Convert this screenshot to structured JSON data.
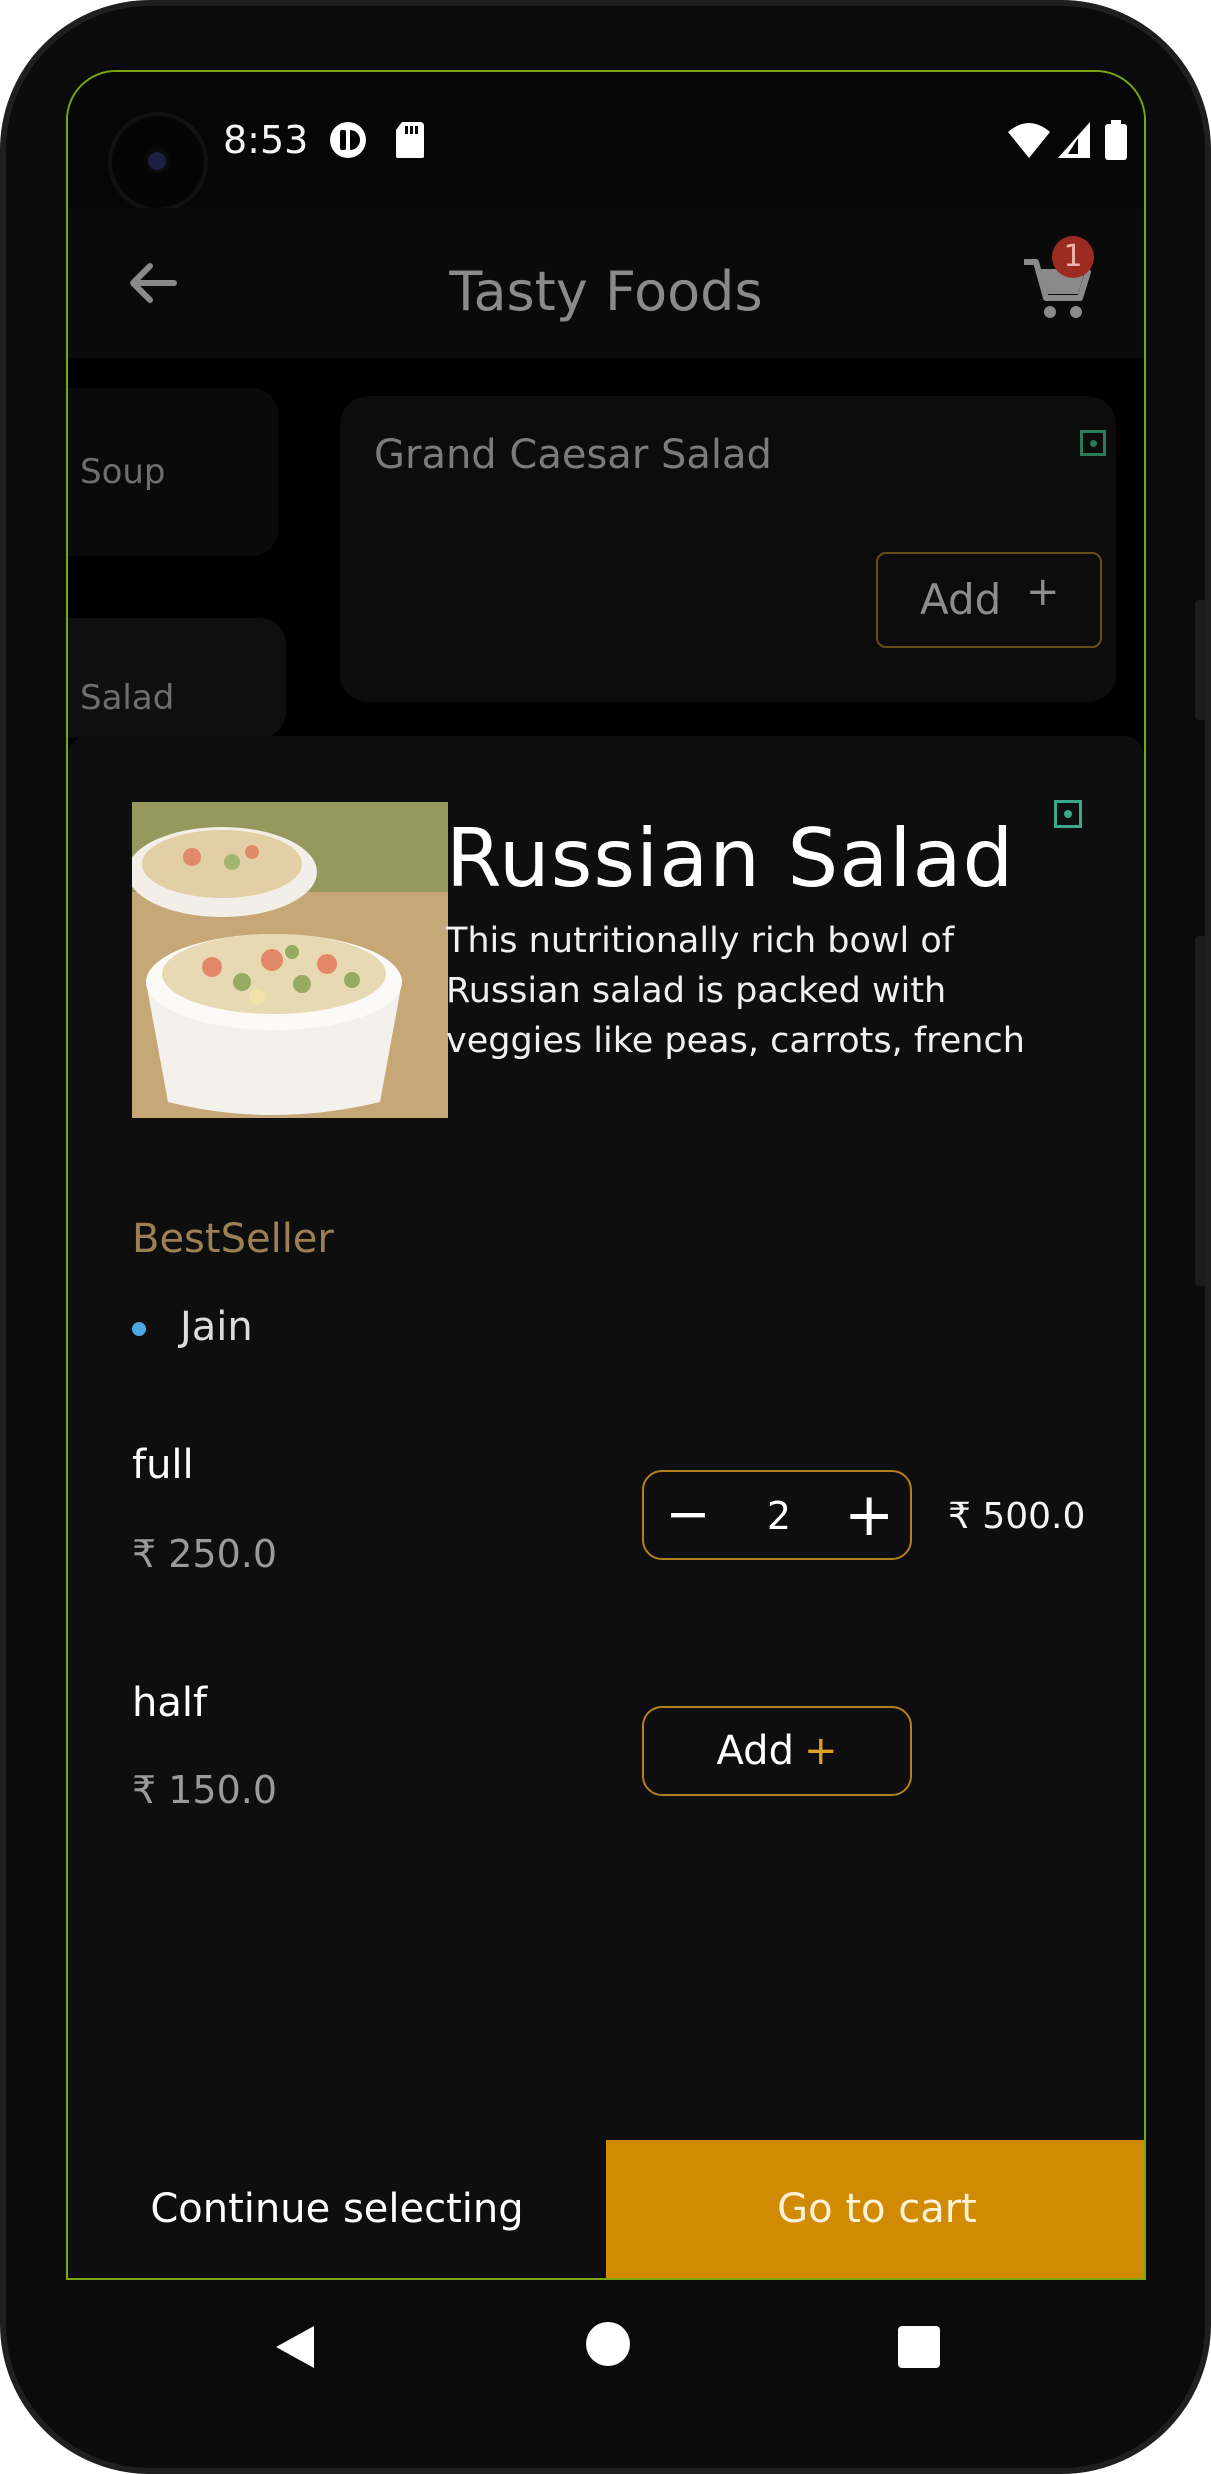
{
  "status_bar": {
    "time": "8:53"
  },
  "app_bar": {
    "title": "Tasty Foods",
    "cart_count": "1"
  },
  "categories": [
    {
      "label": "Soup"
    },
    {
      "label": "Salad"
    }
  ],
  "menu_item": {
    "name": "Grand Caesar Salad",
    "add_label": "Add",
    "add_symbol": "+"
  },
  "dish": {
    "name": "Russian Salad",
    "description": "This nutritionally rich bowl of Russian salad is packed with veggies like peas, carrots, french",
    "badge": "BestSeller",
    "tag": "Jain"
  },
  "variants": [
    {
      "name": "full",
      "price": "₹ 250.0",
      "quantity": "2",
      "total": "₹ 500.0"
    },
    {
      "name": "half",
      "price": "₹ 150.0",
      "add_label": "Add",
      "add_symbol": "+"
    }
  ],
  "footer": {
    "continue_label": "Continue selecting",
    "cart_label": "Go to cart"
  },
  "colors": {
    "accent": "#d18a03",
    "veg": "#3aa88a",
    "screen_border": "#7aa613"
  }
}
